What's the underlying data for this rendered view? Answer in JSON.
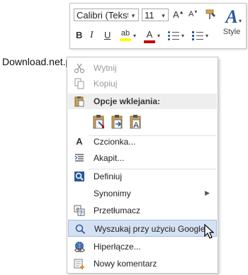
{
  "document": {
    "text": "Download.net.pl"
  },
  "mini_toolbar": {
    "font_name": "Calibri (Tekst p",
    "font_size": "11",
    "style_label": "Style",
    "bold": "B",
    "italic": "I",
    "underline": "U",
    "grow_font": "A",
    "shrink_font": "A",
    "highlight": "ab",
    "font_color": "A",
    "dropdown": "▾",
    "highlight_color": "#ffff00",
    "font_color_value": "#c00000"
  },
  "menu": {
    "items": [
      {
        "label": "Wytnij",
        "icon": "scissors-icon",
        "disabled": true
      },
      {
        "label": "Kopiuj",
        "icon": "copy-icon",
        "disabled": true
      },
      {
        "label": "Opcje wklejania:",
        "icon": "paste-icon",
        "section": true
      },
      {
        "label": "Czcionka...",
        "icon": "font-icon"
      },
      {
        "label": "Akapit...",
        "icon": "paragraph-icon"
      },
      {
        "label": "Definiuj",
        "icon": "search-icon"
      },
      {
        "label": "Synonimy",
        "icon": "none",
        "submenu": true
      },
      {
        "label": "Przetłumacz",
        "icon": "translate-icon"
      },
      {
        "label": "Wyszukaj przy użyciu Google",
        "icon": "search-icon",
        "hovered": true
      },
      {
        "label": "Hiperłącze...",
        "icon": "link-icon"
      },
      {
        "label": "Nowy komentarz",
        "icon": "comment-icon"
      }
    ],
    "paste_icons": [
      "keep-source-formatting-icon",
      "merge-formatting-icon",
      "keep-text-only-icon"
    ],
    "hover_color": "#d5e1f2"
  }
}
